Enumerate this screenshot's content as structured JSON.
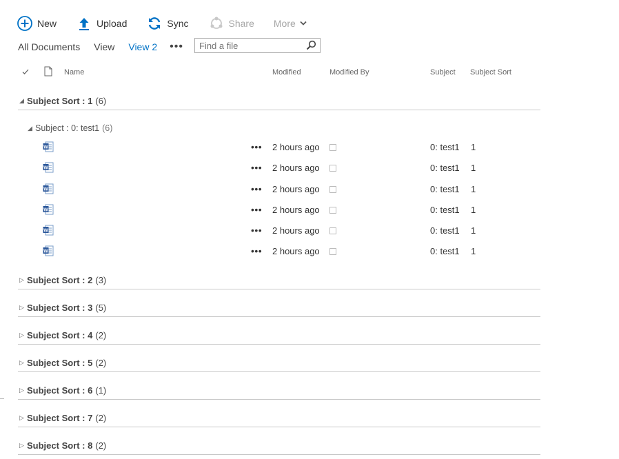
{
  "toolbar": {
    "new_label": "New",
    "upload_label": "Upload",
    "sync_label": "Sync",
    "share_label": "Share",
    "more_label": "More"
  },
  "views": {
    "all_documents": "All Documents",
    "view": "View",
    "view2": "View 2"
  },
  "search": {
    "placeholder": "Find a file"
  },
  "columns": {
    "name": "Name",
    "modified": "Modified",
    "modified_by": "Modified By",
    "subject": "Subject",
    "subject_sort": "Subject Sort"
  },
  "groups": [
    {
      "label": "Subject Sort : 1",
      "count": "(6)",
      "expanded": true
    },
    {
      "label": "Subject Sort : 2",
      "count": "(3)",
      "expanded": false
    },
    {
      "label": "Subject Sort : 3",
      "count": "(5)",
      "expanded": false
    },
    {
      "label": "Subject Sort : 4",
      "count": "(2)",
      "expanded": false
    },
    {
      "label": "Subject Sort : 5",
      "count": "(2)",
      "expanded": false
    },
    {
      "label": "Subject Sort : 6",
      "count": "(1)",
      "expanded": false
    },
    {
      "label": "Subject Sort : 7",
      "count": "(2)",
      "expanded": false
    },
    {
      "label": "Subject Sort : 8",
      "count": "(2)",
      "expanded": false
    }
  ],
  "subgroup": {
    "label": "Subject : 0: test1",
    "count": "(6)"
  },
  "rows": [
    {
      "modified": "2 hours ago",
      "subject": "0: test1",
      "sort": "1"
    },
    {
      "modified": "2 hours ago",
      "subject": "0: test1",
      "sort": "1"
    },
    {
      "modified": "2 hours ago",
      "subject": "0: test1",
      "sort": "1"
    },
    {
      "modified": "2 hours ago",
      "subject": "0: test1",
      "sort": "1"
    },
    {
      "modified": "2 hours ago",
      "subject": "0: test1",
      "sort": "1"
    },
    {
      "modified": "2 hours ago",
      "subject": "0: test1",
      "sort": "1"
    }
  ],
  "colors": {
    "accent": "#0072c6",
    "word_icon": "#2b579a",
    "divider": "#c8c8c8"
  }
}
